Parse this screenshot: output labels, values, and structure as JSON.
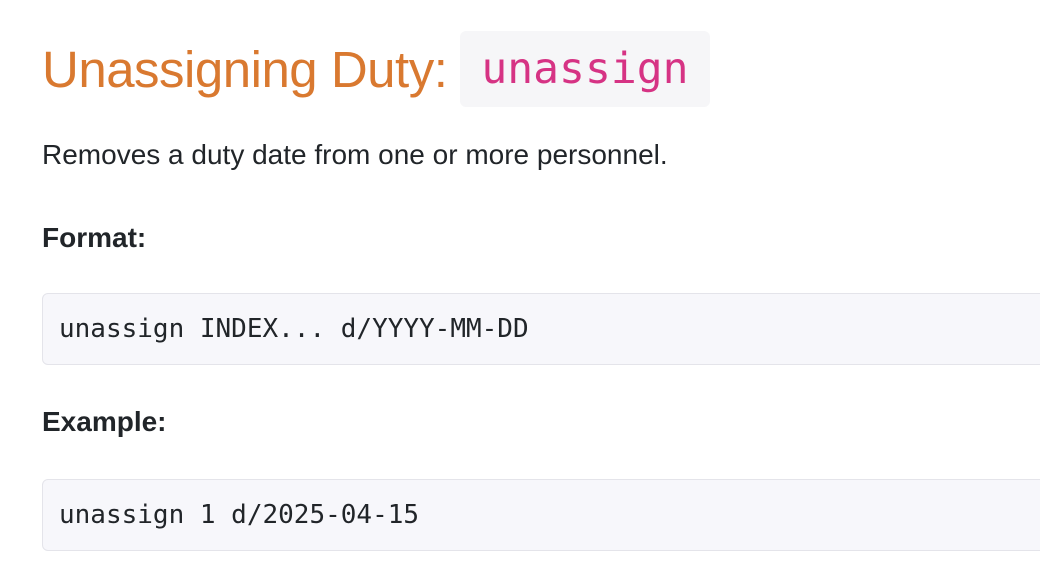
{
  "section": {
    "title": "Unassigning Duty:",
    "title_code": "unassign",
    "description": "Removes a duty date from one or more personnel.",
    "format_label": "Format:",
    "format_code": "unassign INDEX... d/YYYY-MM-DD",
    "example_label": "Example:",
    "example_code": "unassign 1 d/2025-04-15"
  },
  "colors": {
    "heading": "#d97930",
    "inline_code": "#d63384",
    "code_background": "#f7f7fb",
    "text": "#212529"
  }
}
